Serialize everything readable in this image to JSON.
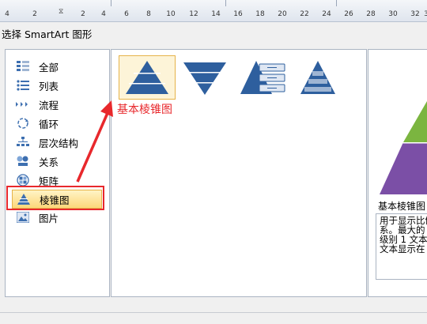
{
  "dialog": {
    "title": "选择 SmartArt 图形"
  },
  "ruler": {
    "ticks": [
      "4",
      "2",
      "2",
      "4",
      "6",
      "8",
      "10",
      "12",
      "14",
      "16",
      "18",
      "20",
      "22",
      "24",
      "26",
      "28",
      "30",
      "32",
      "3"
    ]
  },
  "categories": [
    {
      "label": "全部",
      "icon": "all-grid-icon"
    },
    {
      "label": "列表",
      "icon": "list-icon"
    },
    {
      "label": "流程",
      "icon": "process-arrows-icon"
    },
    {
      "label": "循环",
      "icon": "cycle-icon"
    },
    {
      "label": "层次结构",
      "icon": "hierarchy-icon"
    },
    {
      "label": "关系",
      "icon": "relationship-icon"
    },
    {
      "label": "矩阵",
      "icon": "matrix-icon"
    },
    {
      "label": "棱锥图",
      "icon": "pyramid-icon",
      "selected": true
    },
    {
      "label": "图片",
      "icon": "picture-icon"
    }
  ],
  "thumbnails": [
    {
      "name": "基本棱锥图",
      "kind": "pyramid",
      "selected": true
    },
    {
      "kind": "inverted-pyramid"
    },
    {
      "kind": "pyramid-list"
    },
    {
      "kind": "segmented-pyramid"
    }
  ],
  "annotation": "基本棱锥图",
  "preview": {
    "name": "基本棱锥图",
    "description_lines": [
      "用于显示比例",
      "系。最大的",
      "级别 1 文本",
      "文本显示在"
    ]
  },
  "colors": {
    "highlight": "#e8282c",
    "selection": "#fcd77a",
    "pyramid_blue": "#2e5f9e",
    "preview_green": "#7bb540",
    "preview_purple": "#7b4fa6"
  }
}
